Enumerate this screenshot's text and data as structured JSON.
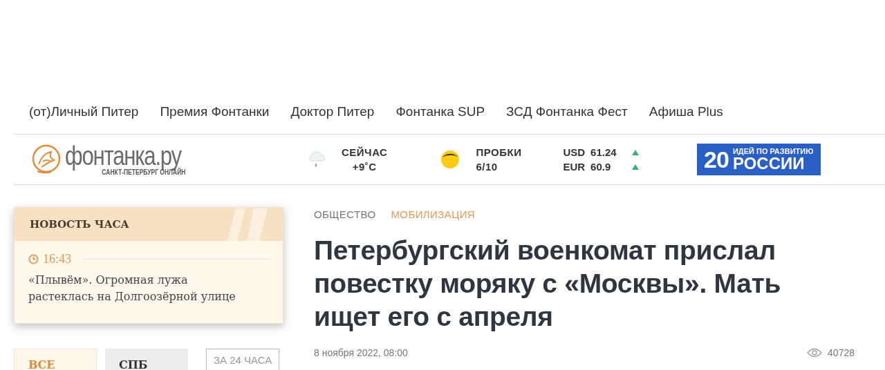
{
  "nav": [
    "(от)Личный Питер",
    "Премия Фонтанки",
    "Доктор Питер",
    "Фонтанка SUP",
    "ЗСД Фонтанка Фест",
    "Афиша Plus"
  ],
  "logo": {
    "name": "фонтанка.ру",
    "tagline": "САНКТ-ПЕТЕРБУРГ ОНЛАЙН"
  },
  "weather": {
    "label": "СЕЙЧАС",
    "value": "+9˚C"
  },
  "traffic": {
    "label": "ПРОБКИ",
    "value": "6/10"
  },
  "rates": [
    {
      "currency": "USD",
      "value": "61.24",
      "rising": true
    },
    {
      "currency": "EUR",
      "value": "60.9",
      "rising": true
    }
  ],
  "banner": {
    "number": "20",
    "top": "ИДЕЙ ПО РАЗВИТИЮ",
    "bottom": "РОССИИ"
  },
  "news_of_hour": {
    "title": "НОВОСТЬ ЧАСА",
    "time": "16:43",
    "text": "«Плывём». Огромная лужа растеклась на Долгоозёрной улице"
  },
  "feed_tabs": [
    {
      "label": "ВСЕ",
      "selected": true
    },
    {
      "label": "СПБ",
      "selected": false
    }
  ],
  "period_button": "ЗА 24 ЧАСА",
  "article": {
    "tags": [
      {
        "label": "ОБЩЕСТВО",
        "kind": "section"
      },
      {
        "label": "МОБИЛИЗАЦИЯ",
        "kind": "topic"
      }
    ],
    "headline": "Петербургский военкомат прислал повестку моряку с «Москвы». Мать ищет его с апреля",
    "date": "8 ноября 2022, 08:00",
    "views": "40728"
  }
}
